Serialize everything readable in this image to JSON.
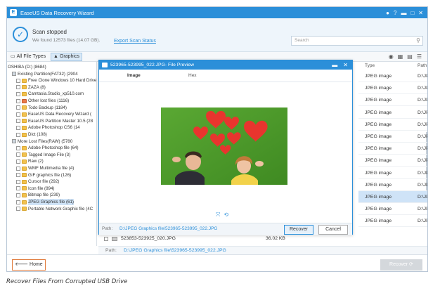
{
  "window": {
    "title": "EaseUS Data Recovery Wizard"
  },
  "status": {
    "title": "Scan stopped",
    "subtitle": "We found 12573 files (14.07 GB).",
    "export_label": "Export Scan Status",
    "search_placeholder": "Search"
  },
  "tabs": {
    "all": "All File Types",
    "graphics": "Graphics"
  },
  "tree": [
    {
      "label": "OSHIBA (D:) (8684)",
      "indent": 0,
      "kind": "none"
    },
    {
      "label": "Existing Partition(FAT32) (2904",
      "indent": 1,
      "kind": "cb"
    },
    {
      "label": "Free Clone Windows 10 Hard Drive t",
      "indent": 2,
      "kind": "folder"
    },
    {
      "label": "ZAZA (8)",
      "indent": 2,
      "kind": "folder"
    },
    {
      "label": "Camtasia.Studio_xp510.com",
      "indent": 2,
      "kind": "folder"
    },
    {
      "label": "Other lost files (1116)",
      "indent": 2,
      "kind": "red"
    },
    {
      "label": "Todo Backup (1184)",
      "indent": 2,
      "kind": "folder"
    },
    {
      "label": "EaseUS Data Recovery Wizard (",
      "indent": 2,
      "kind": "folder"
    },
    {
      "label": "EaseUS Partition Master 10.5 (28",
      "indent": 2,
      "kind": "folder"
    },
    {
      "label": "Adobe Photoshop CS6 (14",
      "indent": 2,
      "kind": "folder"
    },
    {
      "label": "Dict (108)",
      "indent": 2,
      "kind": "folder"
    },
    {
      "label": "More Lost Files(RAW) (5780",
      "indent": 1,
      "kind": "cb"
    },
    {
      "label": "Adobe Photoshop file (64)",
      "indent": 2,
      "kind": "folder"
    },
    {
      "label": "Tagged Image File (3)",
      "indent": 2,
      "kind": "folder"
    },
    {
      "label": "Raw (2)",
      "indent": 2,
      "kind": "folder"
    },
    {
      "label": "WMF Multimedia file (4)",
      "indent": 2,
      "kind": "folder"
    },
    {
      "label": "GIF graphics file (126)",
      "indent": 2,
      "kind": "folder"
    },
    {
      "label": "Cursor file (292)",
      "indent": 2,
      "kind": "folder"
    },
    {
      "label": "Icon file (894)",
      "indent": 2,
      "kind": "folder"
    },
    {
      "label": "Bitmap file (239)",
      "indent": 2,
      "kind": "folder"
    },
    {
      "label": "JPEG Graphics file (61)",
      "indent": 2,
      "kind": "folder",
      "selected": true
    },
    {
      "label": "Portable Network Graphic file (4C",
      "indent": 2,
      "kind": "folder"
    }
  ],
  "list": {
    "headers": {
      "type": "Type",
      "path": "Path"
    },
    "rows": [
      {
        "type": "JPEG image",
        "path": "D:\\JPE"
      },
      {
        "type": "JPEG image",
        "path": "D:\\JPE"
      },
      {
        "type": "JPEG image",
        "path": "D:\\JPE"
      },
      {
        "type": "JPEG image",
        "path": "D:\\JPE"
      },
      {
        "type": "JPEG image",
        "path": "D:\\JPE"
      },
      {
        "type": "JPEG image",
        "path": "D:\\JPE"
      },
      {
        "type": "JPEG image",
        "path": "D:\\JPE"
      },
      {
        "type": "JPEG image",
        "path": "D:\\JPE"
      },
      {
        "type": "JPEG image",
        "path": "D:\\JPE"
      },
      {
        "type": "JPEG image",
        "path": "D:\\JPE"
      },
      {
        "type": "JPEG image",
        "path": "D:\\JPE",
        "selected": true
      },
      {
        "type": "JPEG image",
        "path": "D:\\JPE"
      },
      {
        "type": "JPEG image",
        "path": "D:\\JPE"
      }
    ]
  },
  "file_row": {
    "name": "523853-523925_020.JPG",
    "size": "36.02 KB"
  },
  "path_row": {
    "label": "Path:",
    "value": "D:\\JPEG Graphics file\\523965-523995_022.JPG"
  },
  "dialog": {
    "title": "523965-523995_022.JPG- File Preview",
    "tab_image": "Image",
    "tab_hex": "Hex",
    "path_label": "Path:",
    "path_value": "D:\\JPEG Graphics file\\523965-523995_022.JPG",
    "recover_label": "Recover",
    "cancel_label": "Cancel"
  },
  "footer": {
    "home_label": "🡐 Home",
    "recover_label": "Recover ⟳"
  },
  "caption": "Recover Files From Corrupted USB Drive",
  "colors": {
    "accent": "#2b8fd9",
    "home_border": "#e07a3a",
    "heart": "#e8352e",
    "grass": "#4e9a2c"
  }
}
